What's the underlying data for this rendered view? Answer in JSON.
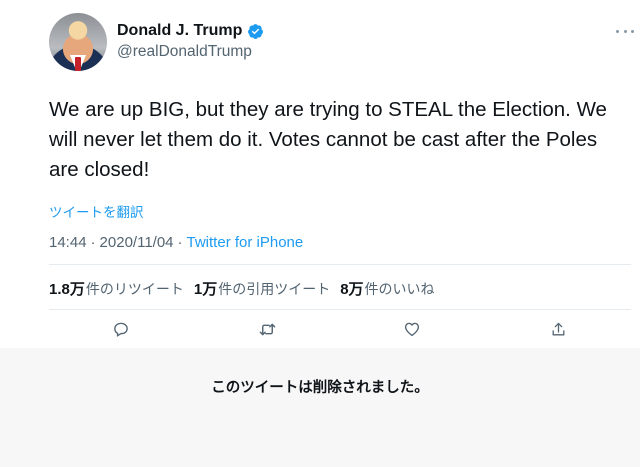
{
  "author": {
    "display_name": "Donald J. Trump",
    "handle": "@realDonaldTrump",
    "verified": true
  },
  "tweet": {
    "text": "We are up BIG, but they are trying to STEAL the Election. We will never let them do it. Votes cannot be cast after the Poles are closed!",
    "translate_label": "ツイートを翻訳",
    "time": "14:44",
    "date": "2020/11/04",
    "separator": "·",
    "source": "Twitter for iPhone"
  },
  "stats": {
    "retweets_count": "1.8万",
    "retweets_unit": "件のリツイート",
    "quotes_count": "1万",
    "quotes_unit": "件の引用ツイート",
    "likes_count": "8万",
    "likes_unit": "件のいいね"
  },
  "actions": [
    "reply-icon",
    "retweet-icon",
    "like-icon",
    "share-icon"
  ],
  "notice": {
    "deleted_message": "このツイートは削除されました。"
  },
  "colors": {
    "link": "#1d9bf0",
    "secondary_text": "#536471",
    "verified_badge": "#1d9bf0",
    "notice_background": "#f7f7f7"
  }
}
